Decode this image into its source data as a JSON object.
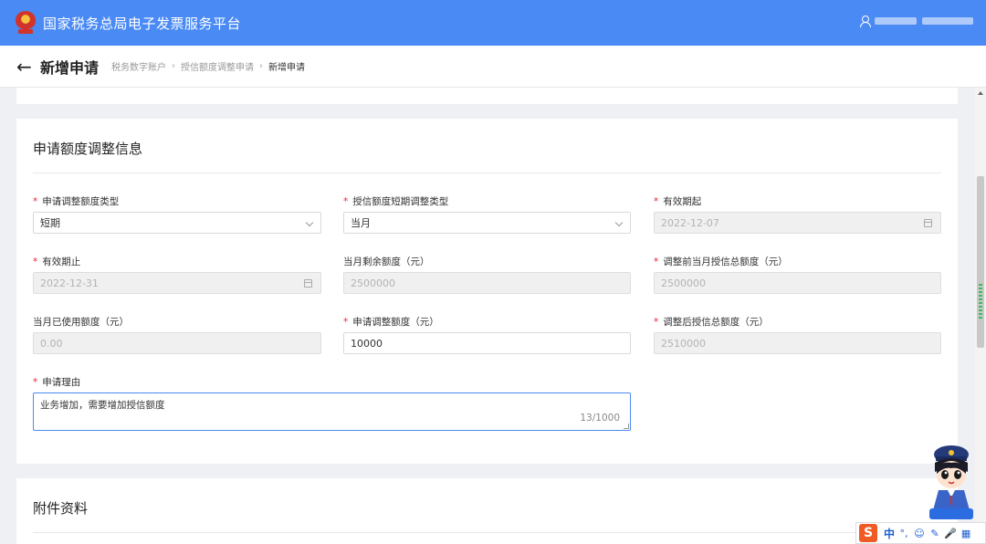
{
  "header": {
    "title": "国家税务总局电子发票服务平台"
  },
  "nav": {
    "title": "新增申请",
    "breadcrumbs": [
      "税务数字账户",
      "授信额度调整申请",
      "新增申请"
    ]
  },
  "sections": {
    "adjust_title": "申请额度调整信息",
    "attachment_title": "附件资料"
  },
  "form": {
    "apply_type": {
      "label": "申请调整额度类型",
      "value": "短期"
    },
    "short_type": {
      "label": "授信额度短期调整类型",
      "value": "当月"
    },
    "valid_from": {
      "label": "有效期起",
      "value": "2022-12-07"
    },
    "valid_to": {
      "label": "有效期止",
      "value": "2022-12-31"
    },
    "month_remaining": {
      "label": "当月剩余额度（元）",
      "value": "2500000"
    },
    "total_before": {
      "label": "调整前当月授信总额度（元）",
      "value": "2500000"
    },
    "month_used": {
      "label": "当月已使用额度（元）",
      "value": "0.00"
    },
    "apply_amount": {
      "label": "申请调整额度（元）",
      "value": "10000"
    },
    "total_after": {
      "label": "调整后授信总额度（元）",
      "value": "2510000"
    },
    "reason": {
      "label": "申请理由",
      "value": "业务增加，需要增加授信额度",
      "count": "13/1000"
    }
  },
  "ime": {
    "logo": "S",
    "lang": "中",
    "punct": "°,",
    "emoji": "☺",
    "pen": "✎",
    "mic": "🎤",
    "grid": "▦"
  }
}
